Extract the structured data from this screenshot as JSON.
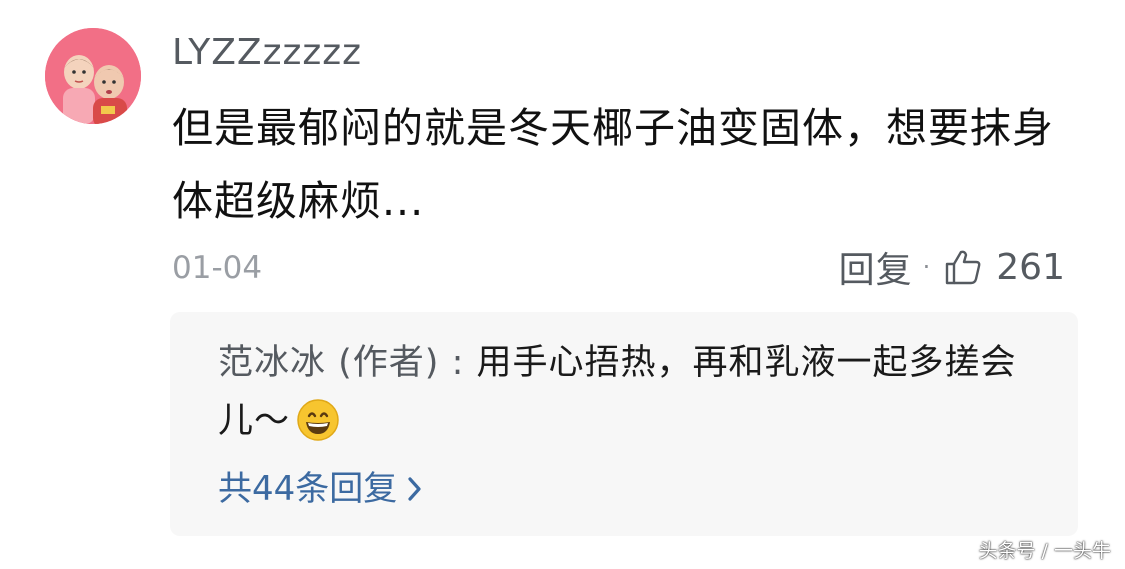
{
  "comment": {
    "username": "LYZZzzzzz",
    "text": "但是最郁闷的就是冬天椰子油变固体，想要抹身体超级麻烦...",
    "date": "01-04",
    "reply_label": "回复",
    "separator": "·",
    "like_count": "261"
  },
  "author_reply": {
    "author": "范冰冰 (作者)",
    "colon": " : ",
    "text": "用手心捂热，再和乳液一起多搓会儿～",
    "emoji": "grinning-face-emoji"
  },
  "more_replies": {
    "label": "共44条回复"
  },
  "watermark": {
    "text": "头条号 / 一头牛"
  },
  "colors": {
    "link": "#3c6aa1",
    "reply_bg": "#f7f7f7",
    "avatar_bg": "#f26f86",
    "secondary_text": "#9a9ea4"
  }
}
